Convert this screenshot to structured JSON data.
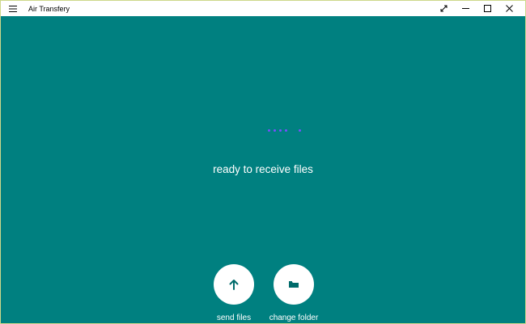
{
  "window": {
    "title": "Air Transfery",
    "controls": [
      "expand-icon",
      "minimize-icon",
      "maximize-icon",
      "close-icon"
    ]
  },
  "main": {
    "status_text": "ready to receive files",
    "loading_indicator": "progress-dots",
    "actions": [
      {
        "label": "send files",
        "icon": "upload-arrow-icon"
      },
      {
        "label": "change folder",
        "icon": "folder-icon"
      }
    ]
  },
  "colors": {
    "background": "#008080",
    "titlebar": "#ffffff",
    "accent_dots": "#7a4dff",
    "button": "#ffffff",
    "text": "#ffffff"
  }
}
